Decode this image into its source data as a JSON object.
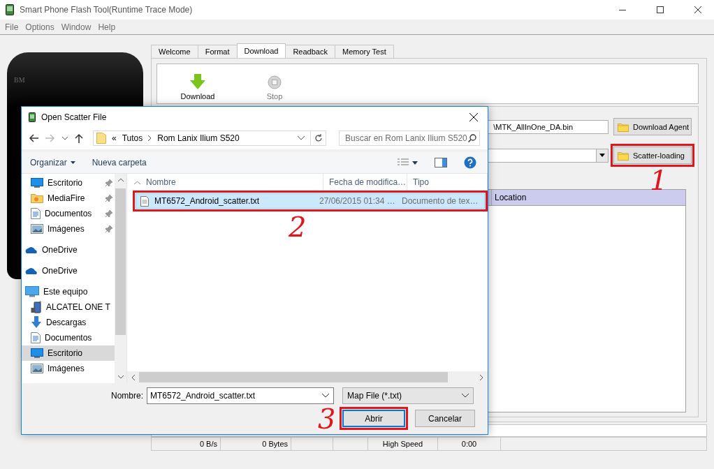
{
  "window": {
    "title": "Smart Phone Flash Tool(Runtime Trace Mode)"
  },
  "menu": [
    "File",
    "Options",
    "Window",
    "Help"
  ],
  "phone": {
    "brand": "BM"
  },
  "tabs": [
    {
      "label": "Welcome",
      "selected": false
    },
    {
      "label": "Format",
      "selected": false
    },
    {
      "label": "Download",
      "selected": true
    },
    {
      "label": "Readback",
      "selected": false
    },
    {
      "label": "Memory Test",
      "selected": false
    }
  ],
  "toolbar": [
    {
      "label": "Download",
      "kind": "download",
      "disabled": false
    },
    {
      "label": "Stop",
      "kind": "stop",
      "disabled": true
    }
  ],
  "download_agent": {
    "path": "\\MTK_AllInOne_DA.bin",
    "button": "Download Agent",
    "highlighted": false
  },
  "scatter": {
    "button": "Scatter-loading",
    "highlighted": true
  },
  "table": {
    "columns": [
      "Location"
    ]
  },
  "progress": {
    "level": 0
  },
  "status_bar": {
    "speed": "0 B/s",
    "bytes": "0 Bytes",
    "mode": "High Speed",
    "time": "0:00"
  },
  "dialog": {
    "title": "Open Scatter File",
    "breadcrumb_overflow": "«",
    "breadcrumb": [
      "Tutos",
      "Rom Lanix Ilium S520"
    ],
    "search": {
      "placeholder": "Buscar en Rom Lanix Ilium S520"
    },
    "commands": [
      {
        "label": "Organizar",
        "kind": "menu"
      },
      {
        "label": "Nueva carpeta",
        "kind": "plain"
      }
    ],
    "nav": [
      {
        "children": [
          {
            "label": "Escritorio",
            "kind": "desktop",
            "pinned": true,
            "selected": false
          },
          {
            "label": "MediaFire",
            "kind": "folder",
            "pinned": true,
            "selected": false
          },
          {
            "label": "Documentos",
            "kind": "document",
            "pinned": true,
            "selected": false
          },
          {
            "label": "Imágenes",
            "kind": "pictures",
            "pinned": true,
            "selected": false
          }
        ]
      },
      {
        "label": "OneDrive",
        "kind": "cloud",
        "pinned": false,
        "selected": false
      },
      {
        "label": "OneDrive",
        "kind": "cloud",
        "pinned": false,
        "selected": false
      },
      {
        "label": "Este equipo",
        "kind": "computer",
        "pinned": false,
        "selected": false,
        "children": [
          {
            "label": "ALCATEL ONE T",
            "kind": "phone",
            "pinned": false,
            "selected": false
          },
          {
            "label": "Descargas",
            "kind": "download",
            "pinned": false,
            "selected": false
          },
          {
            "label": "Documentos",
            "kind": "document",
            "pinned": false,
            "selected": false
          },
          {
            "label": "Escritorio",
            "kind": "desktop",
            "pinned": false,
            "selected": true
          },
          {
            "label": "Imágenes",
            "kind": "pictures",
            "pinned": false,
            "selected": false
          }
        ]
      }
    ],
    "columns": [
      "Nombre",
      "Fecha de modifica…",
      "Tipo"
    ],
    "files": [
      {
        "name": "MT6572_Android_scatter.txt",
        "date": "27/06/2015 01:34 …",
        "type": "Documento de tex…",
        "selected": true,
        "highlighted": true
      }
    ],
    "filename_label": "Nombre:",
    "filename": "MT6572_Android_scatter.txt",
    "filter": "Map File (*.txt)",
    "buttons": [
      {
        "label": "Abrir",
        "kind": "primary",
        "highlighted": true
      },
      {
        "label": "Cancelar",
        "kind": "secondary",
        "highlighted": false
      }
    ]
  },
  "annotations": [
    "1",
    "2",
    "3"
  ]
}
